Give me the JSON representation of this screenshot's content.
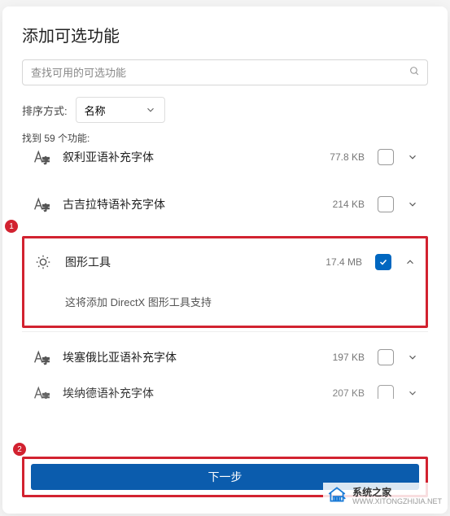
{
  "dialog": {
    "title": "添加可选功能",
    "search_placeholder": "查找可用的可选功能",
    "sort_label": "排序方式:",
    "sort_value": "名称",
    "count_text": "找到 59 个功能:"
  },
  "features": [
    {
      "name": "叙利亚语补充字体",
      "size": "77.8 KB",
      "checked": false,
      "expanded": false,
      "icon": "font"
    },
    {
      "name": "古吉拉特语补充字体",
      "size": "214 KB",
      "checked": false,
      "expanded": false,
      "icon": "font"
    },
    {
      "name": "图形工具",
      "size": "17.4 MB",
      "checked": true,
      "expanded": true,
      "icon": "tool",
      "description": "这将添加 DirectX 图形工具支持"
    },
    {
      "name": "埃塞俄比亚语补充字体",
      "size": "197 KB",
      "checked": false,
      "expanded": false,
      "icon": "font"
    },
    {
      "name": "埃纳德语补充字体",
      "size": "207 KB",
      "checked": false,
      "expanded": false,
      "icon": "font"
    }
  ],
  "buttons": {
    "next": "下一步"
  },
  "badges": {
    "one": "1",
    "two": "2"
  },
  "watermark": {
    "name": "系统之家",
    "url": "WWW.XITONGZHIJIA.NET"
  }
}
